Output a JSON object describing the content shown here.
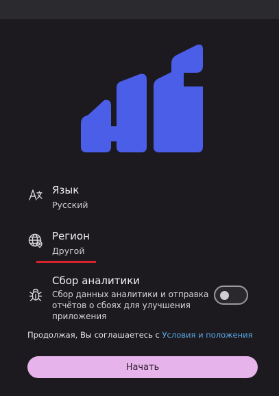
{
  "app": {
    "logo": {
      "name": "Hi",
      "color": "#4b5ee8"
    }
  },
  "settings": {
    "language": {
      "icon": "language-translate-icon",
      "title": "Язык",
      "value": "Русский"
    },
    "region": {
      "icon": "globe-location-icon",
      "title": "Регион",
      "value": "Другой"
    },
    "analytics": {
      "icon": "bug-icon",
      "title": "Сбор аналитики",
      "description": "Сбор данных аналитики и отправка отчётов о сбоях для улучшения приложения",
      "enabled": false
    }
  },
  "consent": {
    "text": "Продолжая, Вы соглашаетесь с ",
    "link_label": "Условия и положения",
    "link_color": "#5aa9e6"
  },
  "start_button": {
    "label": "Начать",
    "color": "#e6b3ea"
  },
  "colors": {
    "background": "#1c1a1e",
    "accent_underline": "#d6242f"
  }
}
